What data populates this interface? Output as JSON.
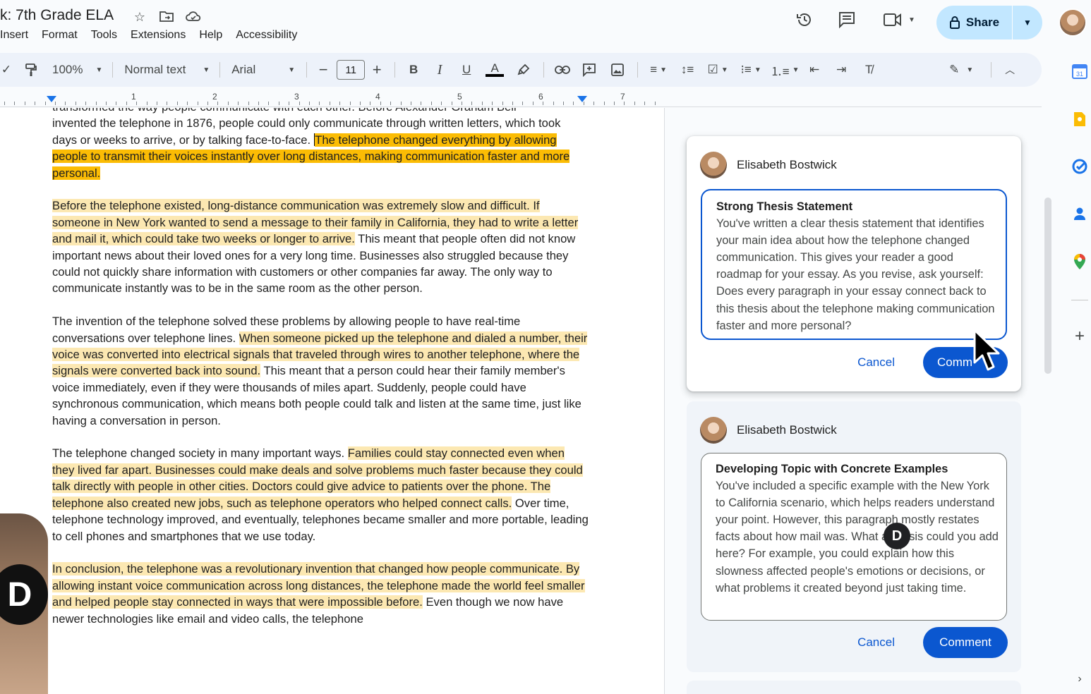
{
  "header": {
    "title": "k: 7th Grade ELA",
    "menu": [
      "Insert",
      "Format",
      "Tools",
      "Extensions",
      "Help",
      "Accessibility"
    ],
    "share_label": "Share"
  },
  "toolbar": {
    "zoom": "100%",
    "style": "Normal text",
    "font": "Arial",
    "font_size": "11"
  },
  "ruler": {
    "numbers": [
      "1",
      "2",
      "3",
      "4",
      "5",
      "6",
      "7"
    ]
  },
  "document": {
    "p1_line0": "transformed the way people communicate with each other. Before Alexander Graham Bell",
    "p1_plain": "invented the telephone in 1876, people could only communicate through written letters, which took days or weeks to arrive, or by talking face-to-face. ",
    "p1_hl": "The telephone changed everything by allowing people to transmit their voices instantly over long distances, making communication faster and more personal.",
    "p2_hl": "Before the telephone existed, long-distance communication was extremely slow and difficult. If someone in New York wanted to send a message to their family in California, they had to write a letter and mail it, which could take two weeks or longer to arrive.",
    "p2_plain": " This meant that people often did not know important news about their loved ones for a very long time. Businesses also struggled because they could not quickly share information with customers or other companies far away. The only way to communicate instantly was to be in the same room as the other person.",
    "p3_plain_a": "The invention of the telephone solved these problems by allowing people to have real-time conversations over telephone lines. ",
    "p3_hl": "When someone picked up the telephone and dialed a number, their voice was converted into electrical signals that traveled through wires to another telephone, where the signals were converted back into sound.",
    "p3_plain_b": " This meant that a person could hear their family member's voice immediately, even if they were thousands of miles apart. Suddenly, people could have synchronous communication, which means both people could talk and listen at the same time, just like having a conversation in person.",
    "p4_plain_a": "The telephone changed society in many important ways. ",
    "p4_hl": "Families could stay connected even when they lived far apart. Businesses could make deals and solve problems much faster because they could talk directly with people in other cities. Doctors could give advice to patients over the phone. The telephone also created new jobs, such as telephone operators who helped connect calls.",
    "p4_plain_b": " Over time, telephone technology improved, and eventually, telephones became smaller and more portable, leading to cell phones and smartphones that we use today.",
    "p5_hl": "In conclusion, the telephone was a revolutionary invention that changed how people communicate. By allowing instant voice communication across long distances, the telephone made the world feel smaller and helped people stay connected in ways that were impossible before.",
    "p5_plain": " Even though we now have newer technologies like email and video calls, the telephone"
  },
  "comments": [
    {
      "author": "Elisabeth Bostwick",
      "title": "Strong Thesis Statement",
      "body": "You've written a clear thesis statement that identifies your main idea about how the telephone changed communication. This gives your reader a good roadmap for your essay. As you revise, ask yourself: Does every paragraph in your essay connect back to this thesis about the telephone making communication faster and more personal?",
      "cancel_label": "Cancel",
      "comment_label": "Comm"
    },
    {
      "author": "Elisabeth Bostwick",
      "title": "Developing Topic with Concrete Examples",
      "body": "You've included a specific example with the New York to California scenario, which helps readers understand your point. However, this paragraph mostly restates facts about how mail was. What analysis could you add here? For example, you could explain how this slowness affected people's emotions or decisions, or what problems it created beyond just taking time.",
      "cancel_label": "Cancel",
      "comment_label": "Comment"
    }
  ],
  "colors": {
    "accent": "#0b57d0",
    "share_bg": "#c2e7ff",
    "highlight_light": "#fce8b2",
    "highlight_strong": "#fbbc04"
  },
  "icons": {
    "title": [
      "star-icon",
      "move-folder-icon",
      "cloud-status-icon"
    ],
    "top_right": [
      "history-icon",
      "comments-icon",
      "meet-icon"
    ],
    "side_panel": [
      "calendar-icon",
      "keep-icon",
      "tasks-icon",
      "contacts-icon",
      "maps-icon",
      "add-icon"
    ]
  }
}
